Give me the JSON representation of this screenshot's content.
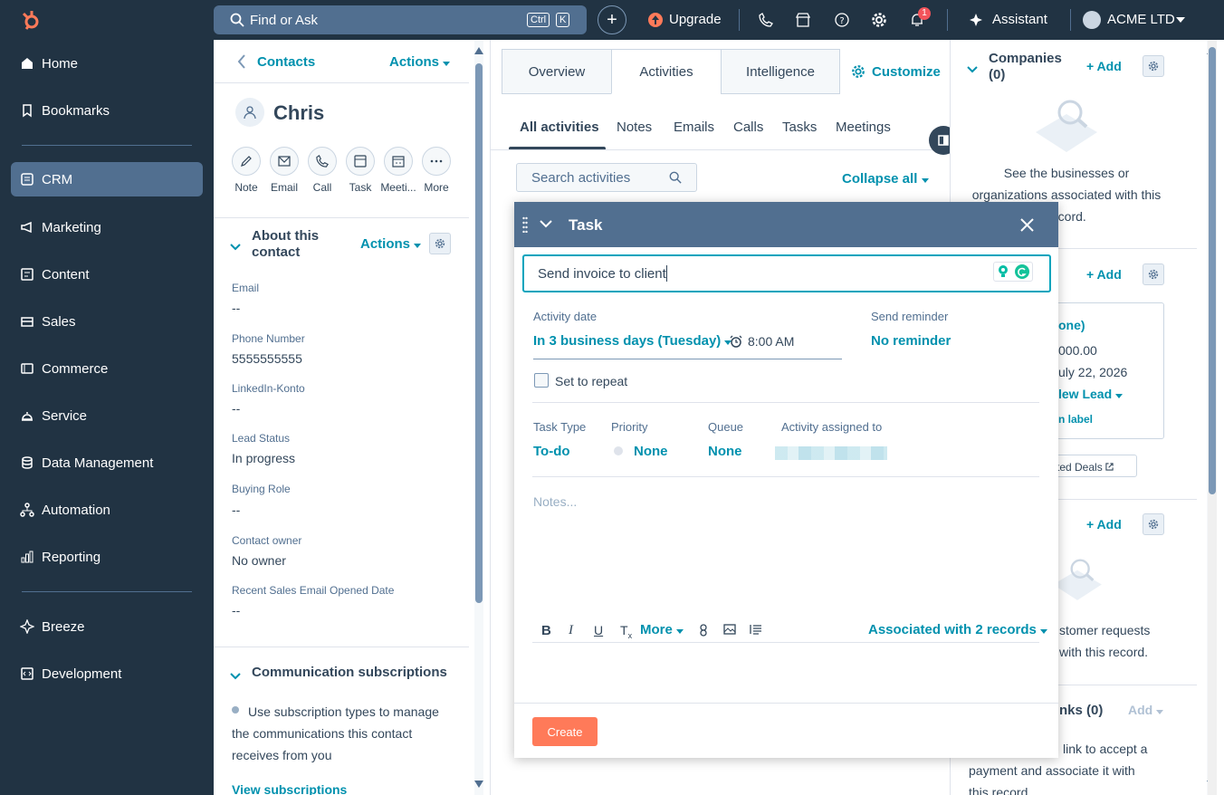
{
  "topbar": {
    "search_placeholder": "Find or Ask",
    "kbd_ctrl": "Ctrl",
    "kbd_k": "K",
    "upgrade": "Upgrade",
    "notif_count": "1",
    "assistant": "Assistant",
    "account": "ACME LTD"
  },
  "sidebar": {
    "items": [
      {
        "label": "Home"
      },
      {
        "label": "Bookmarks"
      },
      {
        "label": "CRM"
      },
      {
        "label": "Marketing"
      },
      {
        "label": "Content"
      },
      {
        "label": "Sales"
      },
      {
        "label": "Commerce"
      },
      {
        "label": "Service"
      },
      {
        "label": "Data Management"
      },
      {
        "label": "Automation"
      },
      {
        "label": "Reporting"
      },
      {
        "label": "Breeze"
      },
      {
        "label": "Development"
      }
    ]
  },
  "left": {
    "back": "Contacts",
    "actions": "Actions",
    "name": "Chris",
    "quick_actions": [
      "Note",
      "Email",
      "Call",
      "Task",
      "Meeti...",
      "More"
    ],
    "about_title": "About this contact",
    "about_actions": "Actions",
    "props": [
      {
        "label": "Email",
        "value": "--"
      },
      {
        "label": "Phone Number",
        "value": "5555555555"
      },
      {
        "label": "LinkedIn-Konto",
        "value": "--"
      },
      {
        "label": "Lead Status",
        "value": "In progress"
      },
      {
        "label": "Buying Role",
        "value": "--"
      },
      {
        "label": "Contact owner",
        "value": "No owner"
      },
      {
        "label": "Recent Sales Email Opened Date",
        "value": "--"
      }
    ],
    "comm_title": "Communication subscriptions",
    "comm_text": "Use subscription types to manage the communications this contact receives from you",
    "view_subs": "View subscriptions"
  },
  "center": {
    "tabs": [
      "Overview",
      "Activities",
      "Intelligence"
    ],
    "customize": "Customize",
    "subtabs": [
      "All activities",
      "Notes",
      "Emails",
      "Calls",
      "Tasks",
      "Meetings"
    ],
    "search_placeholder": "Search activities",
    "collapse_all": "Collapse all"
  },
  "right": {
    "companies_title": "Companies",
    "companies_count": "(0)",
    "add": "Add",
    "companies_empty": "See the businesses or organizations associated with this record.",
    "deal_frag_1": "one)",
    "deal_frag_2": "000.00",
    "deal_frag_3": "uly 22, 2026",
    "deal_frag_4": "lew Lead",
    "deal_frag_5": "n label",
    "deals_link": "ted Deals",
    "tickets_frag_1": "stomer requests",
    "tickets_frag_2": "with this record.",
    "links_frag": "nks (0)",
    "links_add": "Add",
    "links_text_1": "link to accept a",
    "links_text_2": "payment and associate it with",
    "links_text_3": "this record."
  },
  "task_modal": {
    "title": "Task",
    "task_title_value": "Send invoice to client",
    "activity_date_label": "Activity date",
    "activity_date_value": "In 3 business days (Tuesday)",
    "time_value": "8:00 AM",
    "reminder_label": "Send reminder",
    "reminder_value": "No reminder",
    "repeat_label": "Set to repeat",
    "task_type_label": "Task Type",
    "task_type_value": "To-do",
    "priority_label": "Priority",
    "priority_value": "None",
    "queue_label": "Queue",
    "queue_value": "None",
    "assigned_label": "Activity assigned to",
    "notes_placeholder": "Notes...",
    "more_label": "More",
    "associated": "Associated with 2 records",
    "create": "Create"
  },
  "colors": {
    "nav_bg": "#213343",
    "nav_active": "#516f90",
    "link": "#0091ae",
    "focus": "#00a4bd",
    "primary_button": "#ff7a59"
  }
}
